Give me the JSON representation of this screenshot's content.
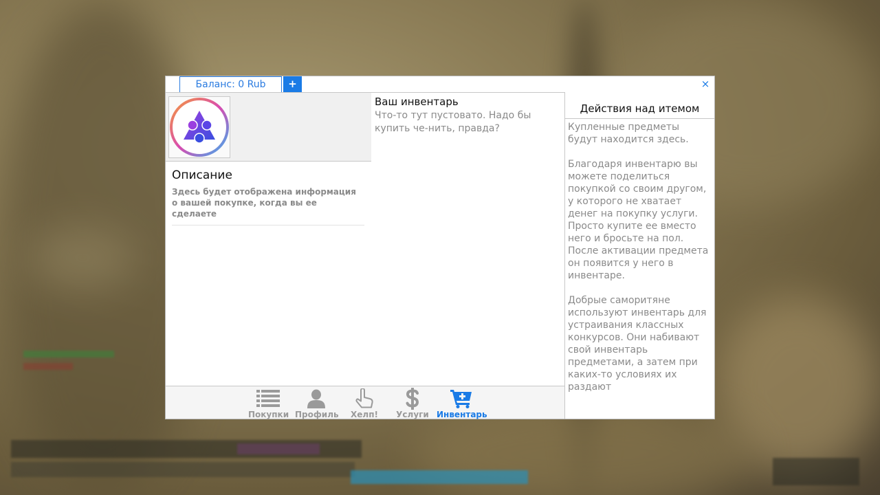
{
  "window": {
    "balance_label": "Баланс: 0 Rub",
    "add_funds_label": "+",
    "close_label": "×"
  },
  "description": {
    "title": "Описание",
    "text": "Здесь будет отображена информация о вашей покупке, когда вы ее сделаете"
  },
  "inventory": {
    "title": "Ваш инвентарь",
    "empty_text": "Что-то тут пустовато. Надо бы купить че-нить, правда?"
  },
  "sidebar": {
    "title": "Действия над итемом",
    "paragraphs": [
      "Купленные предметы будут находится здесь.",
      "Благодаря инвентарю вы можете поделиться покупкой со своим другом, у которого не хватает денег на покупку услуги. Просто купите ее вместо него и бросьте на пол. После активации предмета он появится у него в инвентаре.",
      "Добрые саморитяне используют инвентарь для устраивания классных конкурсов. Они набивают свой инвентарь предметами, а затем при каких-то условиях их раздают"
    ]
  },
  "nav": {
    "items": [
      {
        "label": "Покупки",
        "icon": "list-icon",
        "active": false
      },
      {
        "label": "Профиль",
        "icon": "user-icon",
        "active": false
      },
      {
        "label": "Хелп!",
        "icon": "hand-pointer-icon",
        "active": false
      },
      {
        "label": "Услуги",
        "icon": "dollar-icon",
        "active": false
      },
      {
        "label": "Инвентарь",
        "icon": "cart-plus-icon",
        "active": true
      }
    ]
  },
  "colors": {
    "accent": "#1a7be6",
    "muted_text": "#8a8a8a",
    "inactive_nav": "#9a9a9a"
  }
}
